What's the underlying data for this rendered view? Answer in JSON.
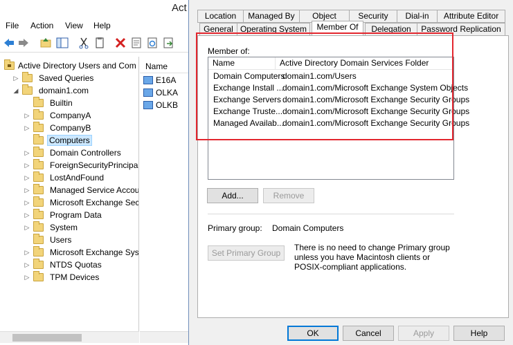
{
  "window": {
    "title": "Act",
    "menu": [
      "File",
      "Action",
      "View",
      "Help"
    ]
  },
  "tree": {
    "root": "Active Directory Users and Com",
    "items": [
      {
        "label": "Saved Queries",
        "level": 1,
        "expand": ">"
      },
      {
        "label": "domain1.com",
        "level": 1,
        "expand": "v"
      },
      {
        "label": "Builtin",
        "level": 2,
        "expand": ""
      },
      {
        "label": "CompanyA",
        "level": 2,
        "expand": ">"
      },
      {
        "label": "CompanyB",
        "level": 2,
        "expand": ">"
      },
      {
        "label": "Computers",
        "level": 2,
        "expand": "",
        "selected": true
      },
      {
        "label": "Domain Controllers",
        "level": 2,
        "expand": ">"
      },
      {
        "label": "ForeignSecurityPrincipals",
        "level": 2,
        "expand": ">"
      },
      {
        "label": "LostAndFound",
        "level": 2,
        "expand": ">"
      },
      {
        "label": "Managed Service Accoun",
        "level": 2,
        "expand": ">"
      },
      {
        "label": "Microsoft Exchange Secu",
        "level": 2,
        "expand": ">"
      },
      {
        "label": "Program Data",
        "level": 2,
        "expand": ">"
      },
      {
        "label": "System",
        "level": 2,
        "expand": ">"
      },
      {
        "label": "Users",
        "level": 2,
        "expand": ""
      },
      {
        "label": "Microsoft Exchange Syste",
        "level": 2,
        "expand": ">"
      },
      {
        "label": "NTDS Quotas",
        "level": 2,
        "expand": ">"
      },
      {
        "label": "TPM Devices",
        "level": 2,
        "expand": ">"
      }
    ]
  },
  "list": {
    "header": "Name",
    "items": [
      "E16A",
      "OLKA",
      "OLKB"
    ]
  },
  "dialog": {
    "tabs_row1": [
      "Location",
      "Managed By",
      "Object",
      "Security",
      "Dial-in",
      "Attribute Editor"
    ],
    "tabs_row2": [
      "General",
      "Operating System",
      "Member Of",
      "Delegation",
      "Password Replication"
    ],
    "active_tab": "Member Of",
    "member_of_label": "Member of:",
    "columns": [
      "Name",
      "Active Directory Domain Services Folder"
    ],
    "rows": [
      {
        "name": "Domain Computers",
        "folder": "domain1.com/Users"
      },
      {
        "name": "Exchange Install ...",
        "folder": "domain1.com/Microsoft Exchange System Objects"
      },
      {
        "name": "Exchange Servers",
        "folder": "domain1.com/Microsoft Exchange Security Groups"
      },
      {
        "name": "Exchange Truste...",
        "folder": "domain1.com/Microsoft Exchange Security Groups"
      },
      {
        "name": "Managed Availab...",
        "folder": "domain1.com/Microsoft Exchange Security Groups"
      }
    ],
    "add_label": "Add...",
    "remove_label": "Remove",
    "primary_group_label": "Primary group:",
    "primary_group_value": "Domain Computers",
    "set_primary_label": "Set Primary Group",
    "note": "There is no need to change Primary group unless you have Macintosh clients or POSIX-compliant applications.",
    "ok_label": "OK",
    "cancel_label": "Cancel",
    "apply_label": "Apply",
    "help_label": "Help"
  },
  "colors": {
    "highlight": "#e3262e",
    "selection": "#cce8ff"
  }
}
